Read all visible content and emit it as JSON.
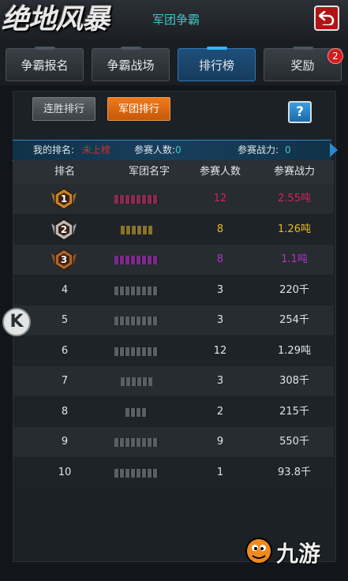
{
  "header": {
    "logo_text": "绝地风暴",
    "subtitle": "军团争霸",
    "back_icon": "back-return-icon"
  },
  "tabs": [
    {
      "label": "争霸报名",
      "active": false
    },
    {
      "label": "争霸战场",
      "active": false
    },
    {
      "label": "排行榜",
      "active": true
    },
    {
      "label": "奖励",
      "active": false,
      "badge": "2"
    }
  ],
  "sort_buttons": {
    "streak": "连胜排行",
    "team": "军团排行",
    "help": "?"
  },
  "info": {
    "my_rank_label": "我的排名:",
    "my_rank_value": "未上榜",
    "players_label": "参赛人数:",
    "players_value": "0",
    "power_label": "参赛战力:",
    "power_value": "0"
  },
  "table": {
    "headers": [
      "排名",
      "军团名字",
      "参赛人数",
      "参赛战力"
    ],
    "rows": [
      {
        "rank": "1",
        "medal": "gold-medal-icon",
        "members": "12",
        "power": "2.55吨",
        "color": "#d6225c"
      },
      {
        "rank": "2",
        "medal": "silver-medal-icon",
        "members": "8",
        "power": "1.26吨",
        "color": "#e8b82c"
      },
      {
        "rank": "3",
        "medal": "bronze-medal-icon",
        "members": "8",
        "power": "1.1吨",
        "color": "#b530c8"
      },
      {
        "rank": "4",
        "members": "3",
        "power": "220千",
        "color": "#e0e4e7"
      },
      {
        "rank": "5",
        "members": "3",
        "power": "254千",
        "color": "#e0e4e7"
      },
      {
        "rank": "6",
        "members": "12",
        "power": "1.29吨",
        "color": "#e0e4e7"
      },
      {
        "rank": "7",
        "members": "3",
        "power": "308千",
        "color": "#e0e4e7"
      },
      {
        "rank": "8",
        "members": "2",
        "power": "215千",
        "color": "#e0e4e7"
      },
      {
        "rank": "9",
        "members": "9",
        "power": "550千",
        "color": "#e0e4e7"
      },
      {
        "rank": "10",
        "members": "1",
        "power": "93.8千",
        "color": "#e0e4e7"
      }
    ]
  },
  "side_button": "K",
  "watermark": "九游"
}
